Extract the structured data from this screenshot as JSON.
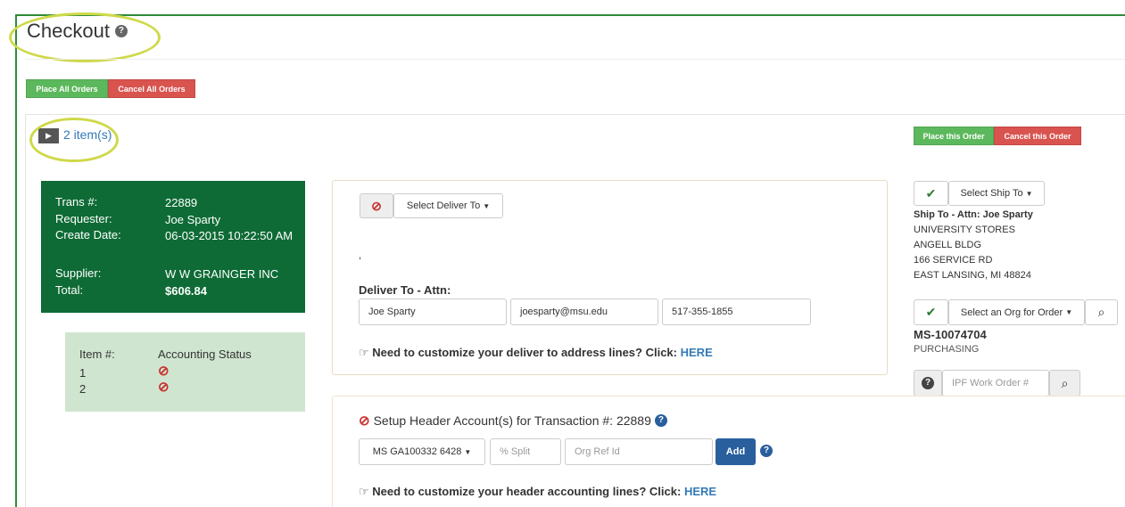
{
  "page": {
    "title": "Checkout"
  },
  "top_buttons": {
    "place_all": "Place All Orders",
    "cancel_all": "Cancel All Orders"
  },
  "order": {
    "items_link": "2 item(s)",
    "place_this": "Place this Order",
    "cancel_this": "Cancel this Order"
  },
  "transaction": {
    "trans_label": "Trans #:",
    "trans_value": "22889",
    "requester_label": "Requester:",
    "requester_value": "Joe Sparty",
    "create_label": "Create Date:",
    "create_value": "06-03-2015 10:22:50 AM",
    "supplier_label": "Supplier:",
    "supplier_value": "W W GRAINGER INC",
    "total_label": "Total:",
    "total_value": "$606.84"
  },
  "items": {
    "col_item": "Item #:",
    "col_status": "Accounting Status",
    "rows": [
      {
        "num": "1"
      },
      {
        "num": "2"
      }
    ]
  },
  "deliver": {
    "select_label": "Select Deliver To",
    "comma": ",",
    "attn_label": "Deliver To - Attn:",
    "name": "Joe Sparty",
    "email": "joesparty@msu.edu",
    "phone": "517-355-1855",
    "hint_text": "Need to customize your deliver to address lines? Click:",
    "hint_link": "HERE"
  },
  "ship_to": {
    "select_label": "Select Ship To",
    "attn": "Ship To - Attn: Joe Sparty",
    "line1": "UNIVERSITY STORES",
    "line2": "ANGELL BLDG",
    "line3": "166 SERVICE RD",
    "line4": "EAST LANSING, MI 48824"
  },
  "org": {
    "select_label": "Select an Org for Order",
    "code": "MS-10074704",
    "name": "PURCHASING"
  },
  "ipf": {
    "placeholder": "IPF Work Order #"
  },
  "header_account": {
    "title": "Setup Header Account(s) for Transaction #: 22889",
    "account_select": "MS GA100332 6428",
    "split_placeholder": "% Split",
    "org_ref_placeholder": "Org Ref Id",
    "add_label": "Add",
    "hint_text": "Need to customize your header accounting lines? Click:",
    "hint_link": "HERE"
  },
  "colors": {
    "green": "#0e6b35",
    "success": "#5cb85c",
    "danger": "#d9534f",
    "link": "#337ab7",
    "highlight": "#cfd94a"
  },
  "icons": [
    "question-circle-icon",
    "play-icon",
    "prohibit-icon",
    "check-icon",
    "search-icon",
    "hand-point-icon",
    "caret-down-icon"
  ]
}
